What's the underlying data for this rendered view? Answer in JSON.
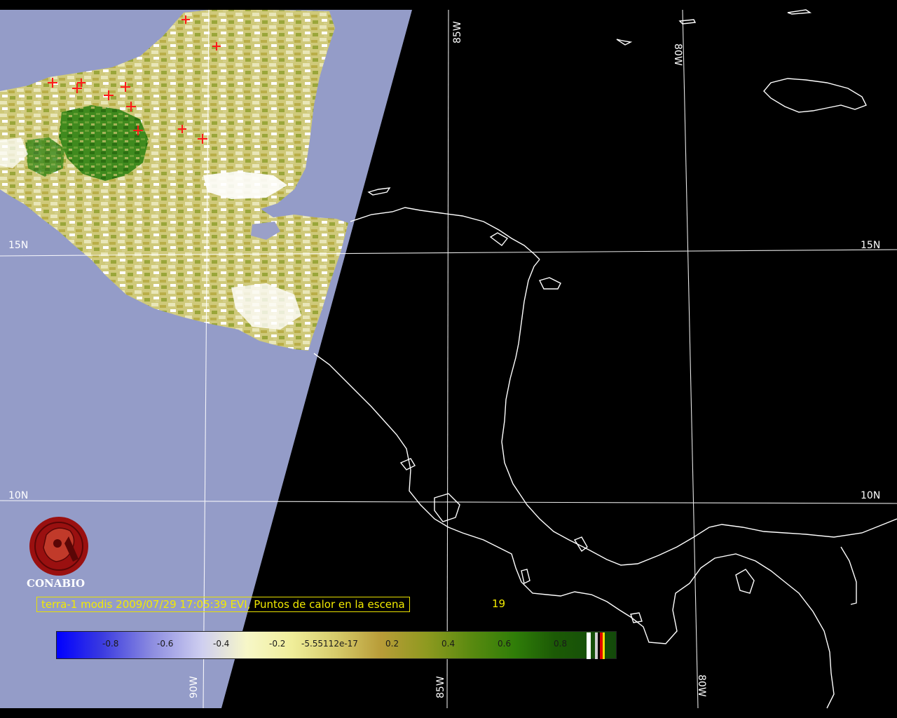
{
  "map": {
    "latitude_labels": [
      "15N",
      "10N"
    ],
    "longitude_labels": [
      "85W",
      "80W",
      "90W"
    ],
    "caption_text": "terra-1 modis 2009/07/29 17:05:39 EVI, Puntos de calor en la escena",
    "hotspot_count": "19",
    "logo_text": "CONABIO"
  },
  "legend": {
    "tick_labels": [
      "-0.8",
      "-0.6",
      "-0.4",
      "-0.2",
      "-5.55112e-17",
      "0.2",
      "0.4",
      "0.6",
      "0.8"
    ]
  },
  "colors": {
    "background": "#000000",
    "no_data_swath": "#949cc8",
    "coastline": "#ffffff",
    "caption": "#f2ea00",
    "hotspot": "#ff1a1a",
    "logo": "#9a1010"
  }
}
